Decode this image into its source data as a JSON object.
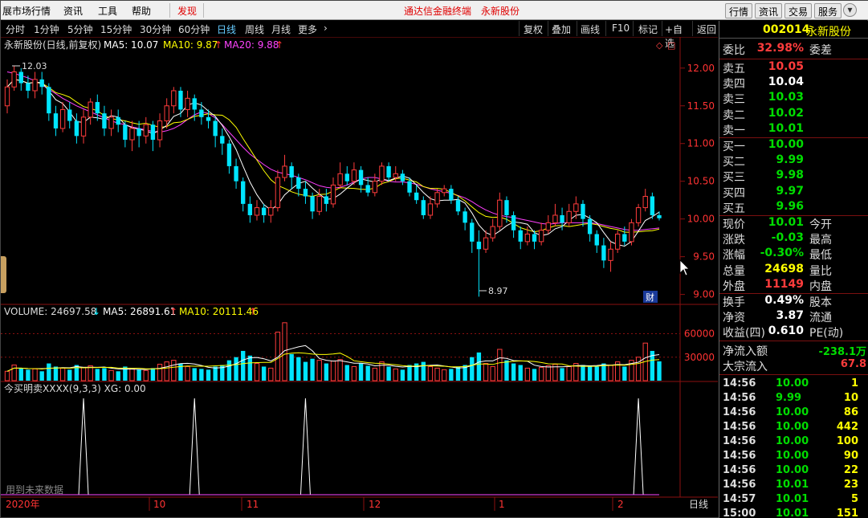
{
  "menubar": {
    "items": [
      "展市场行情",
      "资讯",
      "工具",
      "帮助"
    ],
    "discover": "发现",
    "center_title": "通达信金融终端",
    "center_stock": "永新股份",
    "right_buttons": [
      "行情",
      "资讯",
      "交易",
      "服务"
    ]
  },
  "periods": {
    "items": [
      "分时",
      "1分钟",
      "5分钟",
      "15分钟",
      "30分钟",
      "60分钟",
      "日线",
      "周线",
      "月线",
      "更多"
    ],
    "active": "日线",
    "toolbar": [
      "复权",
      "叠加",
      "画线",
      "F10",
      "标记",
      "+自选",
      "返回"
    ]
  },
  "chart_header": {
    "title": "永新股份(日线,前复权)",
    "ma5": "MA5: 10.07",
    "ma10": "MA10: 9.87",
    "ma20": "MA20: 9.88"
  },
  "volume_header": {
    "volume": "VOLUME: 24697.58",
    "ma5": "MA5: 26891.61",
    "ma10": "MA10: 20111.46"
  },
  "indicator_header": {
    "label": "今买明卖XXXX(9,3,3) XG: 0.00",
    "note": "用到未来数据"
  },
  "chart_labels": {
    "high_label": "12.03",
    "low_label": "8.97",
    "cai": "财"
  },
  "date_axis": [
    "2020年",
    "10",
    "11",
    "12",
    "1",
    "2"
  ],
  "period_tag": "日线",
  "price_axis": [
    "12.00",
    "11.50",
    "11.00",
    "10.50",
    "10.00",
    "9.50",
    "9.00"
  ],
  "volume_axis": [
    "60000",
    "30000"
  ],
  "colors": {
    "up": "#ff3c3c",
    "down": "#00e5ff",
    "ma5": "#ffffff",
    "ma10": "#ffff00",
    "ma20": "#ff40ff",
    "grid": "#8b1010"
  },
  "chart_data": {
    "type": "candlestick",
    "ylim": [
      8.9,
      12.2
    ],
    "volume_ylim": [
      0,
      80000
    ],
    "high": 12.03,
    "low": 8.97,
    "candles": [
      [
        11.5,
        11.75,
        11.85,
        11.4,
        12000
      ],
      [
        11.75,
        11.95,
        12.03,
        11.7,
        20000
      ],
      [
        11.95,
        11.8,
        12.0,
        11.7,
        16000
      ],
      [
        11.8,
        11.7,
        11.9,
        11.6,
        14000
      ],
      [
        11.7,
        11.85,
        11.95,
        11.6,
        15000
      ],
      [
        11.85,
        11.75,
        11.95,
        11.65,
        12000
      ],
      [
        11.75,
        11.4,
        11.8,
        11.3,
        22000
      ],
      [
        11.4,
        11.2,
        11.5,
        11.1,
        18000
      ],
      [
        11.2,
        11.45,
        11.55,
        11.15,
        16000
      ],
      [
        11.45,
        11.3,
        11.55,
        11.2,
        14000
      ],
      [
        11.3,
        11.1,
        11.4,
        11.0,
        20000
      ],
      [
        11.1,
        11.35,
        11.45,
        11.0,
        17000
      ],
      [
        11.35,
        11.55,
        11.6,
        11.25,
        19000
      ],
      [
        11.55,
        11.4,
        11.65,
        11.3,
        15000
      ],
      [
        11.4,
        11.2,
        11.5,
        11.1,
        16000
      ],
      [
        11.2,
        11.35,
        11.45,
        11.1,
        13000
      ],
      [
        11.35,
        11.25,
        11.45,
        11.15,
        12000
      ],
      [
        11.25,
        11.05,
        11.3,
        10.95,
        18000
      ],
      [
        11.05,
        11.2,
        11.3,
        10.9,
        15000
      ],
      [
        11.2,
        11.1,
        11.3,
        10.95,
        14000
      ],
      [
        11.1,
        11.25,
        11.35,
        11.0,
        13000
      ],
      [
        11.25,
        11.05,
        11.3,
        10.9,
        16000
      ],
      [
        11.05,
        11.3,
        11.4,
        10.95,
        21000
      ],
      [
        11.3,
        11.5,
        11.6,
        11.2,
        24000
      ],
      [
        11.5,
        11.7,
        11.75,
        11.4,
        26000
      ],
      [
        11.7,
        11.45,
        11.75,
        11.35,
        22000
      ],
      [
        11.45,
        11.6,
        11.7,
        11.35,
        18000
      ],
      [
        11.6,
        11.45,
        11.65,
        11.3,
        16000
      ],
      [
        11.45,
        11.35,
        11.55,
        11.25,
        15000
      ],
      [
        11.35,
        11.3,
        11.45,
        11.2,
        14000
      ],
      [
        11.3,
        11.1,
        11.35,
        10.95,
        18000
      ],
      [
        11.1,
        11.0,
        11.2,
        10.85,
        20000
      ],
      [
        11.0,
        10.7,
        11.05,
        10.6,
        26000
      ],
      [
        10.7,
        10.5,
        10.8,
        10.4,
        30000
      ],
      [
        10.5,
        10.2,
        10.55,
        10.1,
        38000
      ],
      [
        10.2,
        10.05,
        10.3,
        9.95,
        32000
      ],
      [
        10.05,
        10.15,
        10.25,
        9.98,
        22000
      ],
      [
        10.15,
        10.05,
        10.2,
        9.95,
        18000
      ],
      [
        10.05,
        10.15,
        10.25,
        9.95,
        16000
      ],
      [
        10.15,
        10.55,
        10.65,
        10.1,
        62000
      ],
      [
        10.55,
        10.7,
        10.85,
        10.5,
        74000
      ],
      [
        10.7,
        10.55,
        10.75,
        10.4,
        34000
      ],
      [
        10.55,
        10.4,
        10.6,
        10.3,
        30000
      ],
      [
        10.4,
        10.3,
        10.5,
        10.2,
        24000
      ],
      [
        10.3,
        10.1,
        10.35,
        10.0,
        28000
      ],
      [
        10.1,
        10.3,
        10.4,
        10.05,
        26000
      ],
      [
        10.3,
        10.2,
        10.4,
        10.1,
        22000
      ],
      [
        10.2,
        10.45,
        10.55,
        10.15,
        25000
      ],
      [
        10.45,
        10.6,
        10.75,
        10.4,
        27000
      ],
      [
        10.6,
        10.5,
        10.7,
        10.45,
        20000
      ],
      [
        10.5,
        10.65,
        10.75,
        10.45,
        18000
      ],
      [
        10.65,
        10.45,
        10.7,
        10.35,
        22000
      ],
      [
        10.45,
        10.35,
        10.55,
        10.3,
        19000
      ],
      [
        10.35,
        10.5,
        10.6,
        10.3,
        16000
      ],
      [
        10.5,
        10.7,
        10.75,
        10.45,
        24000
      ],
      [
        10.7,
        10.55,
        10.75,
        10.5,
        18000
      ],
      [
        10.55,
        10.6,
        10.7,
        10.5,
        15000
      ],
      [
        10.6,
        10.5,
        10.65,
        10.45,
        14000
      ],
      [
        10.5,
        10.35,
        10.55,
        10.3,
        20000
      ],
      [
        10.35,
        10.25,
        10.45,
        10.2,
        22000
      ],
      [
        10.25,
        10.05,
        10.3,
        10.0,
        24000
      ],
      [
        10.05,
        10.2,
        10.3,
        10.0,
        18000
      ],
      [
        10.2,
        10.35,
        10.4,
        10.15,
        16000
      ],
      [
        10.35,
        10.4,
        10.45,
        10.3,
        14000
      ],
      [
        10.4,
        10.25,
        10.45,
        10.2,
        15000
      ],
      [
        10.25,
        10.1,
        10.3,
        10.05,
        18000
      ],
      [
        10.1,
        9.95,
        10.15,
        9.85,
        20000
      ],
      [
        9.95,
        9.7,
        10.0,
        9.55,
        30000
      ],
      [
        9.7,
        9.6,
        9.85,
        8.97,
        36000
      ],
      [
        9.6,
        9.75,
        9.85,
        9.55,
        22000
      ],
      [
        9.75,
        9.9,
        10.0,
        9.7,
        18000
      ],
      [
        9.9,
        10.25,
        10.35,
        9.85,
        40000
      ],
      [
        10.25,
        10.05,
        10.3,
        9.95,
        26000
      ],
      [
        10.05,
        9.85,
        10.1,
        9.75,
        22000
      ],
      [
        9.85,
        9.7,
        9.9,
        9.6,
        20000
      ],
      [
        9.7,
        9.8,
        9.9,
        9.65,
        16000
      ],
      [
        9.8,
        9.7,
        9.85,
        9.6,
        15000
      ],
      [
        9.7,
        9.85,
        9.95,
        9.65,
        17000
      ],
      [
        9.85,
        9.95,
        10.05,
        9.8,
        19000
      ],
      [
        9.95,
        10.05,
        10.2,
        9.9,
        21000
      ],
      [
        10.05,
        9.95,
        10.15,
        9.85,
        16000
      ],
      [
        9.95,
        10.1,
        10.2,
        9.9,
        18000
      ],
      [
        10.1,
        10.2,
        10.3,
        10.0,
        22000
      ],
      [
        10.2,
        10.0,
        10.25,
        9.9,
        20000
      ],
      [
        10.0,
        9.8,
        10.05,
        9.7,
        19000
      ],
      [
        9.8,
        9.65,
        9.85,
        9.55,
        18000
      ],
      [
        9.65,
        9.45,
        9.75,
        9.35,
        22000
      ],
      [
        9.45,
        9.6,
        9.7,
        9.3,
        20000
      ],
      [
        9.6,
        9.8,
        9.85,
        9.55,
        24000
      ],
      [
        9.8,
        9.7,
        9.9,
        9.65,
        18000
      ],
      [
        9.7,
        9.95,
        10.0,
        9.65,
        26000
      ],
      [
        9.95,
        10.15,
        10.2,
        9.9,
        30000
      ],
      [
        10.15,
        10.3,
        10.4,
        10.1,
        48000
      ],
      [
        10.3,
        10.05,
        10.35,
        10.0,
        38000
      ],
      [
        10.05,
        10.01,
        10.1,
        9.98,
        24698
      ]
    ],
    "ma20": [
      11.95,
      11.93,
      11.9,
      11.87,
      11.83,
      11.78,
      11.72,
      11.66,
      11.6,
      11.55,
      11.5,
      11.46,
      11.42,
      11.38,
      11.34,
      11.3,
      11.27,
      11.25,
      11.22,
      11.2,
      11.18,
      11.16,
      11.15,
      11.17,
      11.2,
      11.25,
      11.32,
      11.38,
      11.42,
      11.4,
      11.34,
      11.25,
      11.15,
      11.05,
      10.95,
      10.86,
      10.79,
      10.72,
      10.66,
      10.62,
      10.6,
      10.58,
      10.55,
      10.52,
      10.48,
      10.44,
      10.42,
      10.41,
      10.42,
      10.45,
      10.49,
      10.53,
      10.55,
      10.55,
      10.53,
      10.5,
      10.49,
      10.49,
      10.48,
      10.46,
      10.43,
      10.4,
      10.38,
      10.36,
      10.34,
      10.31,
      10.28,
      10.23,
      10.17,
      10.12,
      10.08,
      10.05,
      10.03,
      10.02,
      10.0,
      9.98,
      9.96,
      9.94,
      9.93,
      9.94,
      9.95,
      9.95,
      9.95,
      9.95,
      9.95,
      9.94,
      9.92,
      9.9,
      9.88,
      9.86,
      9.85,
      9.85,
      9.86,
      9.87,
      9.88
    ]
  },
  "indicator_data": {
    "spikes_at_candle": [
      11,
      27,
      43,
      91
    ],
    "ylim": [
      0,
      1
    ]
  },
  "quote": {
    "code": "002014",
    "name": "永新股份",
    "weibi_label": "委比",
    "weibi_value": "32.98%",
    "weicha_label": "委差",
    "asks": [
      {
        "label": "卖五",
        "price": "10.05",
        "color": "#ff3c3c"
      },
      {
        "label": "卖四",
        "price": "10.04",
        "color": "#ffffff"
      },
      {
        "label": "卖三",
        "price": "10.03",
        "color": "#00dd00"
      },
      {
        "label": "卖二",
        "price": "10.02",
        "color": "#00dd00"
      },
      {
        "label": "卖一",
        "price": "10.01",
        "color": "#00dd00"
      }
    ],
    "bids": [
      {
        "label": "买一",
        "price": "10.00",
        "color": "#00dd00"
      },
      {
        "label": "买二",
        "price": "9.99",
        "color": "#00dd00"
      },
      {
        "label": "买三",
        "price": "9.98",
        "color": "#00dd00"
      },
      {
        "label": "买四",
        "price": "9.97",
        "color": "#00dd00"
      },
      {
        "label": "买五",
        "price": "9.96",
        "color": "#00dd00"
      }
    ],
    "stats": [
      {
        "label": "现价",
        "value": "10.01",
        "color": "#00dd00",
        "label2": "今开"
      },
      {
        "label": "涨跌",
        "value": "-0.03",
        "color": "#00dd00",
        "label2": "最高"
      },
      {
        "label": "涨幅",
        "value": "-0.30%",
        "color": "#00dd00",
        "label2": "最低"
      },
      {
        "label": "总量",
        "value": "24698",
        "color": "#ffff00",
        "label2": "量比"
      },
      {
        "label": "外盘",
        "value": "11149",
        "color": "#ff3c3c",
        "label2": "内盘"
      }
    ],
    "stats2": [
      {
        "label": "换手",
        "value": "0.49%",
        "color": "#ffffff",
        "label2": "股本"
      },
      {
        "label": "净资",
        "value": "3.87",
        "color": "#ffffff",
        "label2": "流通"
      },
      {
        "label": "收益(四)",
        "value": "0.610",
        "color": "#ffffff",
        "label2": "PE(动)"
      }
    ],
    "flows": [
      {
        "label": "净流入额",
        "value": "-238.1万",
        "color": "#00dd00"
      },
      {
        "label": "大宗流入",
        "value": "67.8",
        "color": "#ff3c3c"
      }
    ],
    "ticks": [
      {
        "time": "14:56",
        "price": "10.00",
        "vol": "1"
      },
      {
        "time": "14:56",
        "price": "9.99",
        "vol": "10"
      },
      {
        "time": "14:56",
        "price": "10.00",
        "vol": "86"
      },
      {
        "time": "14:56",
        "price": "10.00",
        "vol": "442"
      },
      {
        "time": "14:56",
        "price": "10.00",
        "vol": "100"
      },
      {
        "time": "14:56",
        "price": "10.00",
        "vol": "90"
      },
      {
        "time": "14:56",
        "price": "10.00",
        "vol": "22"
      },
      {
        "time": "14:56",
        "price": "10.01",
        "vol": "23"
      },
      {
        "time": "14:57",
        "price": "10.01",
        "vol": "5"
      },
      {
        "time": "15:00",
        "price": "10.01",
        "vol": "151"
      }
    ]
  }
}
